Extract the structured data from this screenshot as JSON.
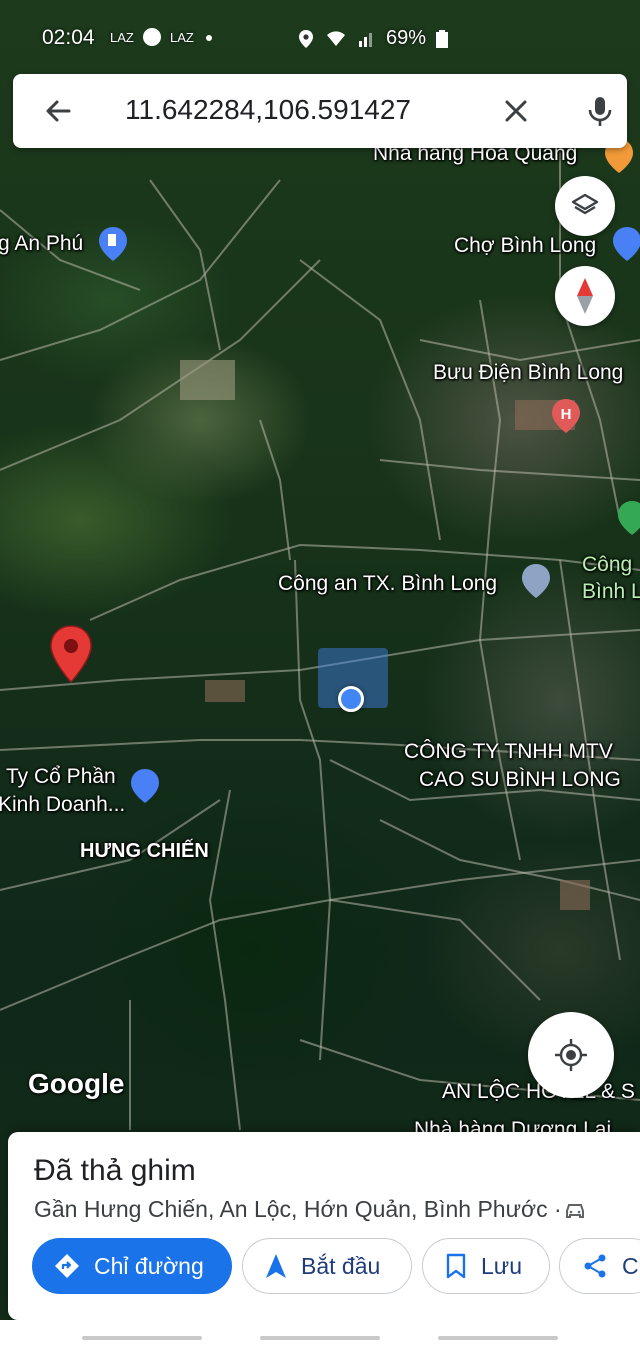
{
  "status_bar": {
    "time": "02:04",
    "notif_icons": [
      "LAZ",
      "facebook-icon",
      "LAZ"
    ],
    "battery": "69%"
  },
  "search": {
    "query": "11.642284,106.591427"
  },
  "map_labels": {
    "nha_hang": "Nhà hàng Hoa Quang",
    "an_phu": "g An Phú",
    "cho_binh_long": "Chợ Bình Long",
    "buu_dien": "Bưu Điện Bình Long",
    "cong_an": "Công an TX. Bình Long",
    "cong_right_1": "Công",
    "cong_right_2": "Bình L",
    "cty_tnhh_1": "CÔNG TY TNHH MTV",
    "cty_tnhh_2": "CAO SU BÌNH LONG",
    "cty_co_phan_1": "Ty Cổ Phần",
    "cty_co_phan_2": "Kinh Doanh...",
    "hung_chien": "HƯNG CHIẾN",
    "an_loc_1": "AN LỘC HOTEL & S",
    "an_loc_2": "Nhà hàng Dương Lai"
  },
  "google_logo": "Google",
  "sheet": {
    "title": "Đã thả ghim",
    "address": "Gần Hưng Chiến, An Lộc, Hớn Quản, Bình Phước ·",
    "actions": {
      "directions": "Chỉ đường",
      "start": "Bắt đầu",
      "save": "Lưu",
      "share": "C"
    }
  },
  "colors": {
    "primary": "#1a73e8",
    "pin": "#e53935",
    "poi_blue": "#4a80f5",
    "poi_red": "#e05a5a",
    "poi_green": "#34a853",
    "poi_orange": "#f29a39"
  }
}
